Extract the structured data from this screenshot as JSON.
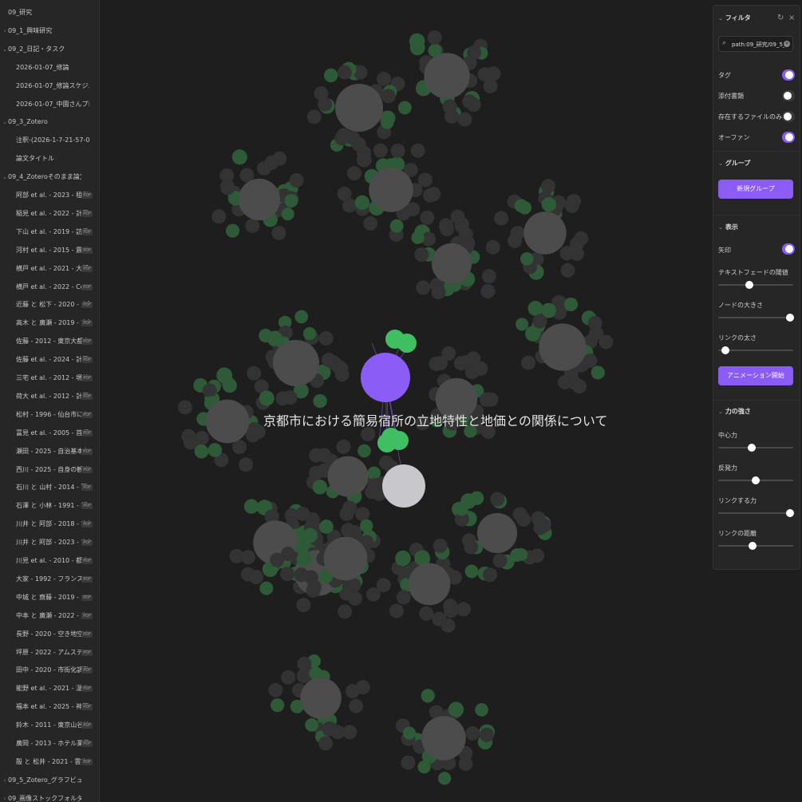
{
  "sidebar": {
    "items": [
      {
        "label": "09_研究",
        "chev": "",
        "indent": 0,
        "pdf": false
      },
      {
        "label": "09_1_興味研究",
        "chev": "›",
        "indent": 1,
        "pdf": false
      },
      {
        "label": "09_2_日記・タスク",
        "chev": "⌄",
        "indent": 1,
        "pdf": false
      },
      {
        "label": "2026-01-07_修論",
        "chev": "",
        "indent": 2,
        "pdf": false
      },
      {
        "label": "2026-01-07_修論スケジュール",
        "chev": "",
        "indent": 2,
        "pdf": false
      },
      {
        "label": "2026-01-07_中園さんプロポ資料…",
        "chev": "",
        "indent": 2,
        "pdf": false
      },
      {
        "label": "09_3_Zotero",
        "chev": "⌄",
        "indent": 1,
        "pdf": false
      },
      {
        "label": "注釈-(2026-1-7-21-57-01)-6UK…",
        "chev": "",
        "indent": 2,
        "pdf": false
      },
      {
        "label": "論文タイトル",
        "chev": "",
        "indent": 2,
        "pdf": false
      },
      {
        "label": "09_4_Zoteroそのまま論文",
        "chev": "⌄",
        "indent": 1,
        "pdf": false
      },
      {
        "label": "阿部 et al. - 2023 - 租税時…",
        "chev": "",
        "indent": 2,
        "pdf": true
      },
      {
        "label": "稲見 et al. - 2022 - 計画的…",
        "chev": "",
        "indent": 2,
        "pdf": true
      },
      {
        "label": "下山 et al. - 2019 - 訪日観…",
        "chev": "",
        "indent": 2,
        "pdf": true
      },
      {
        "label": "河村 et al. - 2015 - 震災被…",
        "chev": "",
        "indent": 2,
        "pdf": true
      },
      {
        "label": "横戸 et al. - 2021 - 大阪市…",
        "chev": "",
        "indent": 2,
        "pdf": true
      },
      {
        "label": "横戸 et al. - 2022 - Covid-1…",
        "chev": "",
        "indent": 2,
        "pdf": true
      },
      {
        "label": "近藤 と 松下 - 2020 - 大阪…",
        "chev": "",
        "indent": 2,
        "pdf": true
      },
      {
        "label": "高木 と 廣瀬 - 2019 - 市街…",
        "chev": "",
        "indent": 2,
        "pdf": true
      },
      {
        "label": "佐藤 - 2012 - 東京大都市圏…",
        "chev": "",
        "indent": 2,
        "pdf": true
      },
      {
        "label": "佐藤 et al. - 2024 - 計画的…",
        "chev": "",
        "indent": 2,
        "pdf": true
      },
      {
        "label": "三宅 et al. - 2012 - 堺外戸…",
        "chev": "",
        "indent": 2,
        "pdf": true
      },
      {
        "label": "荷大 et al. - 2012 - 計画的…",
        "chev": "",
        "indent": 2,
        "pdf": true
      },
      {
        "label": "松村 - 1996 - 仙台市におけ…",
        "chev": "",
        "indent": 2,
        "pdf": true
      },
      {
        "label": "冨見 et al. - 2005 - 首都圏…",
        "chev": "",
        "indent": 2,
        "pdf": true
      },
      {
        "label": "瀬田 - 2025 - 自治基本条例…",
        "chev": "",
        "indent": 2,
        "pdf": true
      },
      {
        "label": "西川 - 2025 - 自身の観光統…",
        "chev": "",
        "indent": 2,
        "pdf": true
      },
      {
        "label": "石川 と 山村 - 2014 - 国内…",
        "chev": "",
        "indent": 2,
        "pdf": true
      },
      {
        "label": "石澤 と 小林 - 1991 - 都市に…",
        "chev": "",
        "indent": 2,
        "pdf": true
      },
      {
        "label": "川井 と 阿部 - 2018 - 京都…",
        "chev": "",
        "indent": 2,
        "pdf": true
      },
      {
        "label": "川井 と 阿部 - 2023 - 京都…",
        "chev": "",
        "indent": 2,
        "pdf": true
      },
      {
        "label": "川見 et al. - 2010 - 都市農…",
        "chev": "",
        "indent": 2,
        "pdf": true
      },
      {
        "label": "大家 - 1992 - フランスの住…",
        "chev": "",
        "indent": 2,
        "pdf": true
      },
      {
        "label": "中城 と 齋藤 - 2019 - マン…",
        "chev": "",
        "indent": 2,
        "pdf": true
      },
      {
        "label": "中本 と 廣瀬 - 2022 - 産立…",
        "chev": "",
        "indent": 2,
        "pdf": true
      },
      {
        "label": "長野 - 2020 - 空き地空き家…",
        "chev": "",
        "indent": 2,
        "pdf": true
      },
      {
        "label": "坪原 - 2022 - アムステルダ…",
        "chev": "",
        "indent": 2,
        "pdf": true
      },
      {
        "label": "田中 - 2020 - 市街化調整区…",
        "chev": "",
        "indent": 2,
        "pdf": true
      },
      {
        "label": "能野 et al. - 2021 - 温泉観…",
        "chev": "",
        "indent": 2,
        "pdf": true
      },
      {
        "label": "福本 et al. - 2025 - 神戸市…",
        "chev": "",
        "indent": 2,
        "pdf": true
      },
      {
        "label": "鈴木 - 2011 - 東京山谷地域…",
        "chev": "",
        "indent": 2,
        "pdf": true
      },
      {
        "label": "廣岡 - 2013 - ホテル業界の…",
        "chev": "",
        "indent": 2,
        "pdf": true
      },
      {
        "label": "殷 と 松井 - 2021 - 雲南省…",
        "chev": "",
        "indent": 2,
        "pdf": true
      },
      {
        "label": "09_5_Zotero_グラフビュー用",
        "chev": "›",
        "indent": 1,
        "pdf": false
      },
      {
        "label": "09_画像ストックフォルダ",
        "chev": "›",
        "indent": 0,
        "pdf": false
      }
    ],
    "pdf_badge": "PDF"
  },
  "graph": {
    "focus_label": "京都市における簡易宿所の立地特性と地価との関係について",
    "colors": {
      "focus": "#8b5cf6",
      "tag": "#3fbf62",
      "attach": "#4a4a4a",
      "file": "#6e6e6e",
      "highlight": "#c8c8cc",
      "green": "#2e5a38"
    }
  },
  "panel": {
    "filter": {
      "title": "フィルタ",
      "search_value": "path:09_研究/09_5_Zotero",
      "rows": [
        {
          "label": "タグ",
          "on": true
        },
        {
          "label": "添付書類",
          "on": false
        },
        {
          "label": "存在するファイルのみ表示",
          "on": false
        },
        {
          "label": "オーファン",
          "on": true
        }
      ]
    },
    "group": {
      "title": "グループ",
      "new_group_button": "新規グループ"
    },
    "display": {
      "title": "表示",
      "arrow_label": "矢印",
      "arrow_on": true,
      "sliders": [
        {
          "label": "テキストフェードの閾値",
          "value": 0.42
        },
        {
          "label": "ノードの大きさ",
          "value": 0.96
        },
        {
          "label": "リンクの太さ",
          "value": 0.1
        }
      ],
      "animate_button": "アニメーション開始"
    },
    "forces": {
      "title": "力の強さ",
      "sliders": [
        {
          "label": "中心力",
          "value": 0.45
        },
        {
          "label": "反発力",
          "value": 0.5
        },
        {
          "label": "リンクする力",
          "value": 0.96
        },
        {
          "label": "リンクの距離",
          "value": 0.46
        }
      ]
    }
  }
}
